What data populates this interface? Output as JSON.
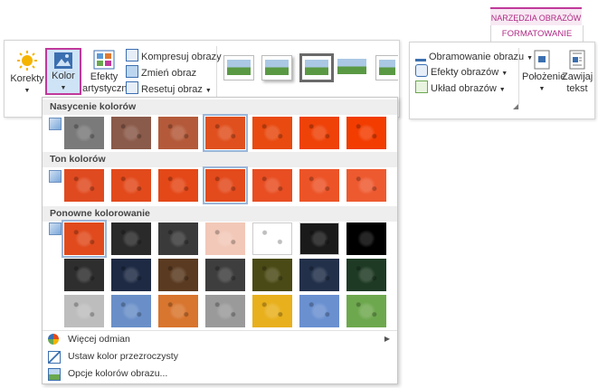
{
  "tabs": {
    "tools_header": "NARZĘDZIA OBRAZÓW",
    "format_tab": "FORMATOWANIE"
  },
  "ribbon": {
    "corrections": "Korekty",
    "color": "Kolor",
    "artistic_effects_1": "Efekty",
    "artistic_effects_2": "artystyczne",
    "compress": "Kompresuj obrazy",
    "change": "Zmień obraz",
    "reset": "Resetuj obraz",
    "border": "Obramowanie obrazu",
    "effects": "Efekty obrazów",
    "layout": "Układ obrazów",
    "position": "Położenie",
    "wrap_1": "Zawijaj",
    "wrap_2": "tekst"
  },
  "menu": {
    "saturation_header": "Nasycenie kolorów",
    "tone_header": "Ton kolorów",
    "recolor_header": "Ponowne kolorowanie",
    "more_variations": "Więcej odmian",
    "set_transparent": "Ustaw kolor przezroczysty",
    "color_options": "Opcje kolorów obrazu..."
  },
  "swatches": {
    "saturation": [
      "#7a7a7a",
      "#8a5a4a",
      "#b45a3a",
      "#e0501e",
      "#e84a10",
      "#ee4208",
      "#f23c00"
    ],
    "tone": [
      "#e04a20",
      "#e24a1c",
      "#e44818",
      "#e34a1c",
      "#e84e22",
      "#ec5428",
      "#ee5a30"
    ],
    "recolor_row1": [
      "#e04a1c",
      "#2a2a2a",
      "#3a3a3a",
      "#f2c8b8",
      "#ffffff",
      "#1a1a1a",
      "#000000"
    ],
    "recolor_row2": [
      "#2e2e2e",
      "#1e2a44",
      "#5a3a20",
      "#3e3e3e",
      "#4a4a16",
      "#22304a",
      "#1e3a24"
    ],
    "recolor_row3": [
      "#bdbdbd",
      "#6a8fc8",
      "#d8752e",
      "#9a9a9a",
      "#e8b01c",
      "#6a90d0",
      "#6ea84e"
    ]
  },
  "colors": {
    "accent": "#c0399a",
    "selected": "#cfe3f6"
  }
}
